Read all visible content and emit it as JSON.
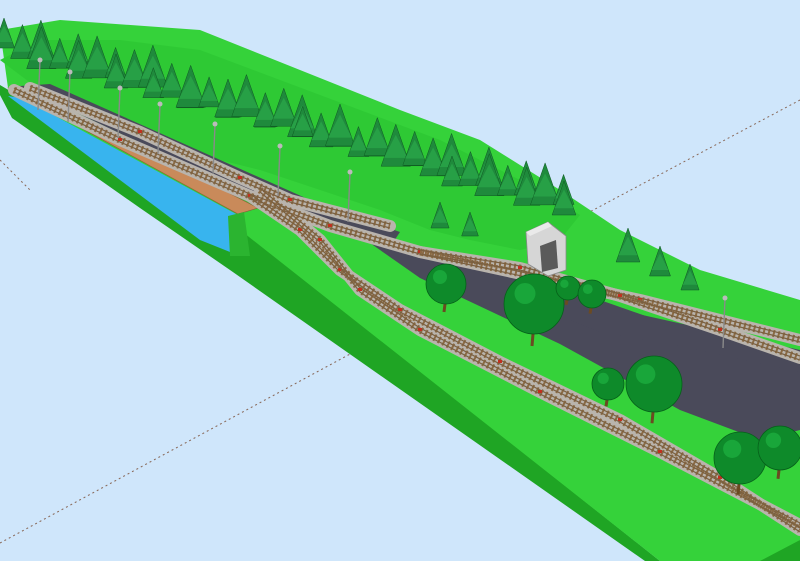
{
  "scene": {
    "kind": "3d-model-railway-layout-render",
    "colors": {
      "sky": "#cfe6fb",
      "grass": "#35d23a",
      "grass_dark": "#22b82a",
      "grass_side": "#1fa524",
      "water": "#38b4ee",
      "wall": "#c98a5a",
      "road": "#4a4a5a",
      "ballast": "#b9b4ad",
      "rail": "#7a6040",
      "sleeper": "#8a6a44",
      "marker": "#c03020",
      "conifer": "#1f8a3c",
      "tree": "#0e8a2a",
      "trunk": "#6b4a22",
      "lamp": "#8a8a8a",
      "building": "#d6d6d6"
    },
    "icons": [
      "conifer-tree-icon",
      "round-tree-icon",
      "street-lamp-icon",
      "tunnel-portal-icon"
    ],
    "labels": []
  }
}
